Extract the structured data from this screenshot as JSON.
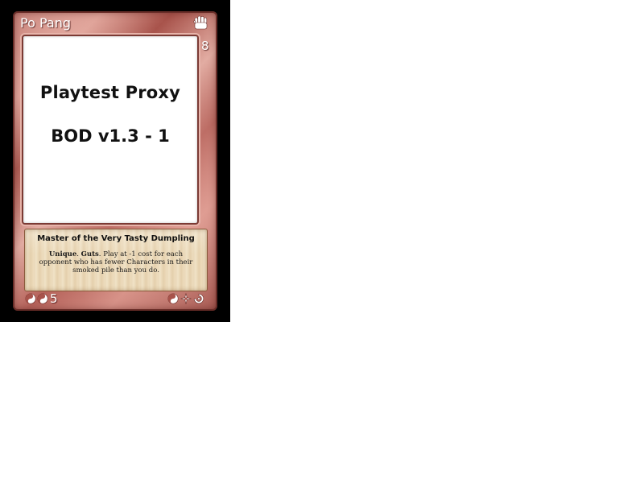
{
  "card": {
    "name": "Po Pang",
    "fighting": "8",
    "proxy_title": "Playtest Proxy",
    "proxy_version": "BOD v1.3 - 1",
    "subtitle": "Master of the Very Tasty Dumpling",
    "rules_keyword_1": "Unique",
    "rules_sep_1": ". ",
    "rules_keyword_2": "Guts",
    "rules_body": ". Play at -1 cost for each opponent who has fewer Characters in their smoked pile than you do.",
    "cost": "5",
    "type_icon": "fist-icon",
    "cost_icons": [
      "chi-icon",
      "chi-icon"
    ],
    "resource_icons": [
      "chi-icon",
      "magic-star-icon",
      "tech-swirl-icon"
    ],
    "colors": {
      "frame": "#b86a62",
      "border": "#000000",
      "parchment": "#ecdcbc"
    }
  }
}
